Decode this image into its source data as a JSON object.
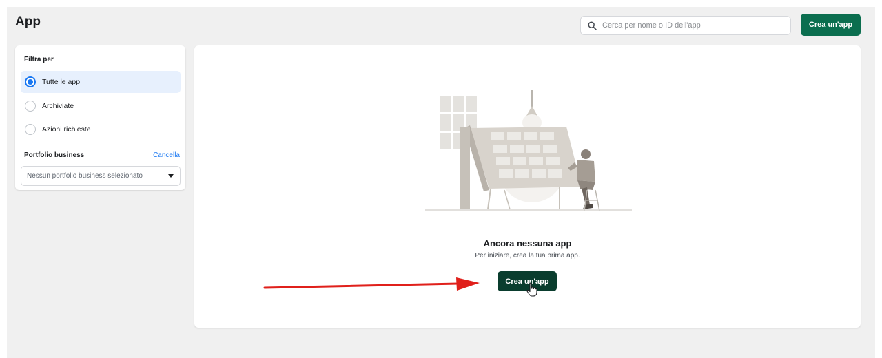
{
  "header": {
    "title": "App",
    "search_placeholder": "Cerca per nome o ID dell'app",
    "create_label": "Crea un'app"
  },
  "filters": {
    "title": "Filtra per",
    "options": [
      {
        "label": "Tutte le app",
        "selected": true
      },
      {
        "label": "Archiviate",
        "selected": false
      },
      {
        "label": "Azioni richieste",
        "selected": false
      }
    ],
    "portfolio_label": "Portfolio business",
    "cancel_label": "Cancella",
    "portfolio_select_value": "Nessun portfolio business selezionato"
  },
  "empty_state": {
    "title": "Ancora nessuna app",
    "subtitle": "Per iniziare, crea la tua prima app.",
    "button_label": "Crea un'app"
  },
  "colors": {
    "primary_green": "#0b6e4f",
    "dark_green": "#0a3d2e",
    "accent_blue": "#1877f2",
    "annotation_red": "#e0201b"
  },
  "icons": [
    "search-icon",
    "caret-down-icon",
    "pointer-cursor-icon",
    "red-arrow"
  ]
}
